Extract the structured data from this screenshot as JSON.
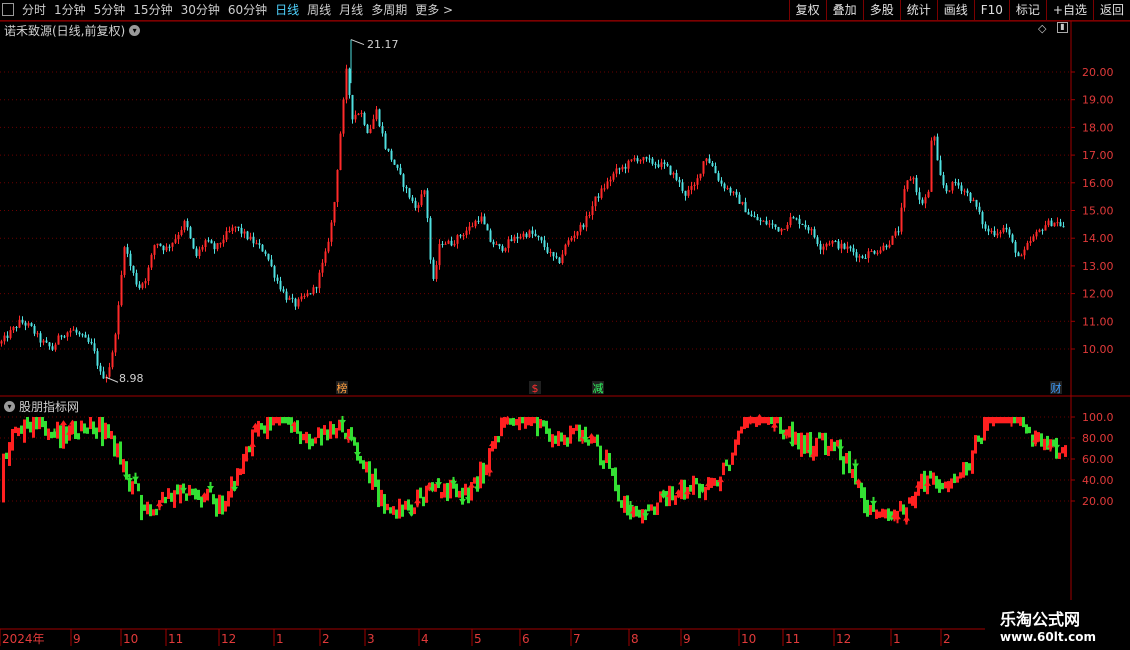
{
  "toolbar": {
    "periods": [
      "分时",
      "1分钟",
      "5分钟",
      "15分钟",
      "30分钟",
      "60分钟",
      "日线",
      "周线",
      "月线",
      "多周期",
      "更多 >"
    ],
    "active_period": "日线",
    "buttons": [
      "复权",
      "叠加",
      "多股",
      "统计",
      "画线",
      "F10",
      "标记",
      "+自选",
      "返回"
    ]
  },
  "main_pane": {
    "title": "诺禾致源(日线,前复权)",
    "high_label": "21.17",
    "low_label": "8.98",
    "y_ticks": [
      "20.00",
      "19.00",
      "18.00",
      "17.00",
      "16.00",
      "15.00",
      "14.00",
      "13.00",
      "12.00",
      "11.00",
      "10.00"
    ],
    "events": [
      {
        "label": "榜",
        "color": "#ff9f40"
      },
      {
        "label": "$",
        "color": "#ff3030"
      },
      {
        "label": "减",
        "color": "#30ff60"
      },
      {
        "label": "财",
        "color": "#40a0ff"
      }
    ]
  },
  "indicator_pane": {
    "title": "股朋指标网",
    "y_ticks": [
      "100.0",
      "80.00",
      "60.00",
      "40.00",
      "20.00"
    ]
  },
  "x_axis": {
    "labels": [
      "2024年",
      "9",
      "10",
      "11",
      "12",
      "1",
      "2",
      "3",
      "4",
      "5",
      "6",
      "7",
      "8",
      "9",
      "10",
      "11",
      "12",
      "1",
      "2"
    ]
  },
  "watermark": {
    "line1": "乐淘公式网",
    "line2": "www.60lt.com"
  },
  "colors": {
    "up": "#ff2a2a",
    "down": "#4fe0e0",
    "ind_up": "#ff2020",
    "ind_down": "#33e033",
    "grid": "#6a0000",
    "border": "#a00000"
  },
  "chart_data": {
    "type": "candlestick",
    "y_range": [
      9.0,
      21.17
    ],
    "price_path": [
      [
        0,
        10.2
      ],
      [
        10,
        10.6
      ],
      [
        20,
        11.0
      ],
      [
        30,
        10.8
      ],
      [
        40,
        10.3
      ],
      [
        52,
        10.0
      ],
      [
        60,
        10.5
      ],
      [
        72,
        10.7
      ],
      [
        82,
        10.4
      ],
      [
        92,
        10.1
      ],
      [
        100,
        9.1
      ],
      [
        106,
        8.98
      ],
      [
        112,
        9.8
      ],
      [
        118,
        11.5
      ],
      [
        124,
        13.8
      ],
      [
        130,
        13.0
      ],
      [
        138,
        12.2
      ],
      [
        146,
        12.6
      ],
      [
        155,
        13.9
      ],
      [
        165,
        13.6
      ],
      [
        175,
        14.0
      ],
      [
        185,
        14.6
      ],
      [
        195,
        13.3
      ],
      [
        205,
        13.9
      ],
      [
        215,
        13.6
      ],
      [
        225,
        14.1
      ],
      [
        235,
        14.4
      ],
      [
        245,
        14.1
      ],
      [
        255,
        13.8
      ],
      [
        265,
        13.5
      ],
      [
        275,
        12.6
      ],
      [
        285,
        11.9
      ],
      [
        295,
        11.6
      ],
      [
        305,
        11.9
      ],
      [
        315,
        12.2
      ],
      [
        325,
        13.4
      ],
      [
        333,
        14.9
      ],
      [
        340,
        17.8
      ],
      [
        346,
        20.0
      ],
      [
        352,
        18.4
      ],
      [
        360,
        18.6
      ],
      [
        368,
        17.8
      ],
      [
        376,
        18.6
      ],
      [
        385,
        17.3
      ],
      [
        395,
        16.6
      ],
      [
        405,
        15.8
      ],
      [
        415,
        15.1
      ],
      [
        425,
        15.8
      ],
      [
        432,
        12.2
      ],
      [
        440,
        13.9
      ],
      [
        450,
        13.8
      ],
      [
        460,
        14.1
      ],
      [
        470,
        14.4
      ],
      [
        480,
        14.8
      ],
      [
        490,
        13.9
      ],
      [
        500,
        13.6
      ],
      [
        510,
        13.9
      ],
      [
        520,
        14.1
      ],
      [
        530,
        14.2
      ],
      [
        540,
        13.9
      ],
      [
        550,
        13.4
      ],
      [
        558,
        13.1
      ],
      [
        566,
        13.8
      ],
      [
        575,
        14.2
      ],
      [
        585,
        14.6
      ],
      [
        595,
        15.4
      ],
      [
        605,
        15.9
      ],
      [
        615,
        16.4
      ],
      [
        625,
        16.6
      ],
      [
        635,
        16.9
      ],
      [
        645,
        16.8
      ],
      [
        655,
        16.7
      ],
      [
        665,
        16.6
      ],
      [
        675,
        16.2
      ],
      [
        685,
        15.6
      ],
      [
        695,
        15.9
      ],
      [
        705,
        17.0
      ],
      [
        712,
        16.6
      ],
      [
        720,
        16.0
      ],
      [
        730,
        15.7
      ],
      [
        740,
        15.3
      ],
      [
        750,
        14.8
      ],
      [
        760,
        14.6
      ],
      [
        770,
        14.5
      ],
      [
        780,
        14.3
      ],
      [
        790,
        14.7
      ],
      [
        800,
        14.6
      ],
      [
        810,
        14.3
      ],
      [
        820,
        13.7
      ],
      [
        830,
        13.9
      ],
      [
        840,
        13.7
      ],
      [
        850,
        13.6
      ],
      [
        860,
        13.3
      ],
      [
        870,
        13.5
      ],
      [
        880,
        13.6
      ],
      [
        890,
        13.9
      ],
      [
        898,
        14.3
      ],
      [
        905,
        15.9
      ],
      [
        912,
        16.3
      ],
      [
        920,
        15.2
      ],
      [
        928,
        15.6
      ],
      [
        932,
        18.2
      ],
      [
        938,
        16.4
      ],
      [
        945,
        15.7
      ],
      [
        955,
        16.0
      ],
      [
        965,
        15.7
      ],
      [
        975,
        15.2
      ],
      [
        985,
        14.3
      ],
      [
        995,
        14.2
      ],
      [
        1005,
        14.4
      ],
      [
        1012,
        13.8
      ],
      [
        1020,
        13.2
      ],
      [
        1028,
        13.8
      ],
      [
        1035,
        14.1
      ],
      [
        1045,
        14.5
      ],
      [
        1055,
        14.6
      ],
      [
        1064,
        14.4
      ]
    ]
  }
}
